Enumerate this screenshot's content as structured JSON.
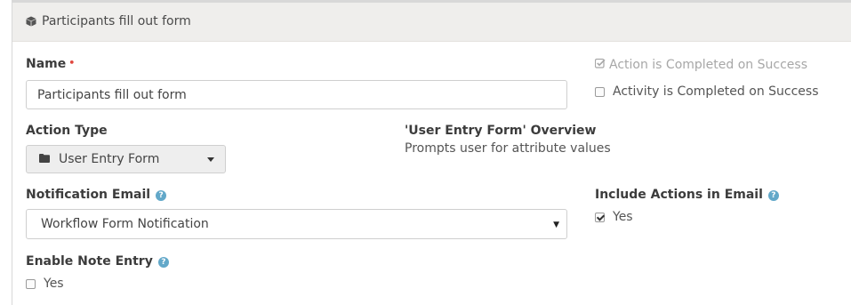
{
  "panel": {
    "title": "Participants fill out form",
    "icon": "cube-icon"
  },
  "name_field": {
    "label": "Name",
    "required_marker": "•",
    "value": "Participants fill out form"
  },
  "options": {
    "action_completed_label": "Action is Completed on Success",
    "action_completed_checked": true,
    "action_completed_disabled": true,
    "activity_completed_label": "Activity is Completed on Success",
    "activity_completed_checked": false
  },
  "action_type": {
    "label": "Action Type",
    "value": "User Entry Form",
    "icon": "folder-icon"
  },
  "overview": {
    "title": "'User Entry Form' Overview",
    "description": "Prompts user for attribute values"
  },
  "notification_email": {
    "label": "Notification Email",
    "help_icon": "question-circle-icon",
    "selected": "Workflow Form Notification"
  },
  "include_actions": {
    "label": "Include Actions in Email",
    "help_icon": "question-circle-icon",
    "option_label": "Yes",
    "checked": true
  },
  "enable_note": {
    "label": "Enable Note Entry",
    "help_icon": "question-circle-icon",
    "option_label": "Yes",
    "checked": false
  },
  "colors": {
    "header_bg": "#efeeec",
    "required": "#e0473f",
    "help": "#62a8c9",
    "muted_text": "#a7a7a7"
  }
}
